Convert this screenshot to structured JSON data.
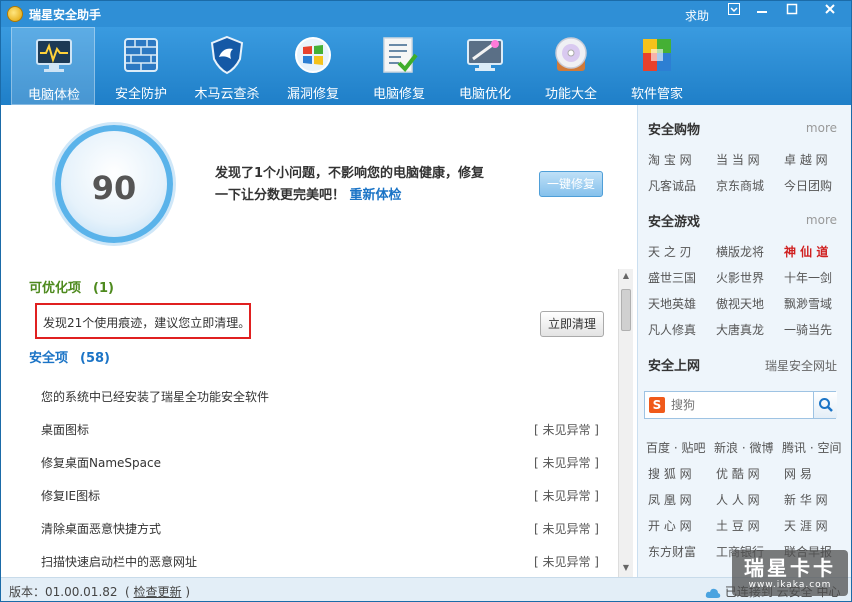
{
  "window": {
    "title": "瑞星安全助手",
    "help": "求助",
    "menu_icon": "menu-icon",
    "minimize_icon": "minimize-icon",
    "maximize_icon": "maximize-icon",
    "close_icon": "close-icon"
  },
  "toolbar": {
    "items": [
      {
        "label": "电脑体检",
        "icon": "monitor-heartbeat-icon"
      },
      {
        "label": "安全防护",
        "icon": "firewall-icon"
      },
      {
        "label": "木马云查杀",
        "icon": "shield-icon"
      },
      {
        "label": "漏洞修复",
        "icon": "windows-patch-icon"
      },
      {
        "label": "电脑修复",
        "icon": "checklist-icon"
      },
      {
        "label": "电脑优化",
        "icon": "optimize-icon"
      },
      {
        "label": "功能大全",
        "icon": "disc-icon"
      },
      {
        "label": "软件管家",
        "icon": "software-blocks-icon"
      }
    ]
  },
  "checkup": {
    "score": "90",
    "summary_line1": "发现了1个小问题，不影响您的电脑健康，修复",
    "summary_line2": "一下让分数更完美吧！",
    "recheck": "重新体检",
    "fix_all": "一键修复"
  },
  "optimizable": {
    "title": "可优化项",
    "count": "(1)",
    "issue": "发现21个使用痕迹，建议您立即清理。",
    "clean_button": "立即清理"
  },
  "security": {
    "title": "安全项",
    "count": "(58)",
    "intro": "您的系统中已经安装了瑞星全功能安全软件",
    "items": [
      {
        "name": "桌面图标",
        "status": "[ 未见异常 ]"
      },
      {
        "name": "修复桌面NameSpace",
        "status": "[ 未见异常 ]"
      },
      {
        "name": "修复IE图标",
        "status": "[ 未见异常 ]"
      },
      {
        "name": "清除桌面恶意快捷方式",
        "status": "[ 未见异常 ]"
      },
      {
        "name": "扫描快速启动栏中的恶意网址",
        "status": "[ 未见异常 ]"
      }
    ]
  },
  "sidebar": {
    "shopping": {
      "title": "安全购物",
      "more": "more",
      "links": [
        "淘 宝 网",
        "当 当 网",
        "卓 越 网",
        "凡客诚品",
        "京东商城",
        "今日团购"
      ]
    },
    "games": {
      "title": "安全游戏",
      "more": "more",
      "links": [
        "天 之 刃",
        "横版龙将",
        "神 仙 道",
        "盛世三国",
        "火影世界",
        "十年一剑",
        "天地英雄",
        "傲视天地",
        "飘渺雪域",
        "凡人修真",
        "大唐真龙",
        "一骑当先"
      ]
    },
    "web": {
      "title": "安全上网",
      "sub": "瑞星安全网址",
      "search_placeholder": "搜狗",
      "search_engine_icon": "sogou-icon",
      "links": [
        "百度 · 贴吧",
        "新浪 · 微博",
        "腾讯 · 空间",
        "搜 狐 网",
        "优 酷 网",
        "网 易",
        "凤 凰 网",
        "人 人 网",
        "新 华 网",
        "开 心 网",
        "土 豆 网",
        "天 涯 网",
        "东方财富",
        "工商银行",
        "联合早报"
      ]
    }
  },
  "status": {
    "version": "版本：01.00.01.82",
    "check_update": "检查更新",
    "cloud": "已连接到 云安全 中心"
  },
  "watermark": {
    "main": "瑞星卡卡",
    "sub": "www.ikaka.com"
  },
  "colors": {
    "title_bar": "#2f8fd6",
    "toolbar": "#1f7fc8",
    "accent_green": "#4e8a1e",
    "accent_blue": "#1b74c6",
    "highlight_red": "#e02020"
  }
}
